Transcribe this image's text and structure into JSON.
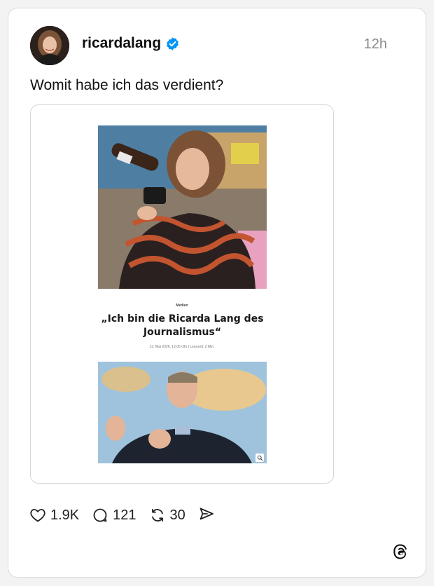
{
  "post": {
    "username": "ricardalang",
    "verified": true,
    "timestamp": "12h",
    "text": "Womit habe ich das verdient?"
  },
  "embed": {
    "category": "Medien",
    "title": "„Ich bin die Ricarda Lang des Journalismus“",
    "date": "13. Mai 2026, 12:05 Uhr",
    "read_time": "Lesezeit: 2 Min."
  },
  "actions": {
    "likes": "1.9K",
    "replies": "121",
    "reposts": "30"
  },
  "colors": {
    "verified_badge": "#0095f6",
    "timestamp": "#8a8a8a",
    "border": "#d9d9d9"
  },
  "icons": [
    "heart-icon",
    "comment-icon",
    "repost-icon",
    "send-icon",
    "threads-logo-icon",
    "verified-icon",
    "zoom-icon"
  ]
}
